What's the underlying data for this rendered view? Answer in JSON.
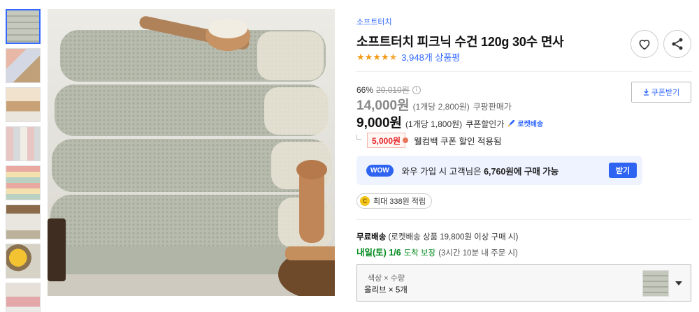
{
  "thumbnails": [
    {
      "name": "thumb-1",
      "active": true
    },
    {
      "name": "thumb-2",
      "active": false
    },
    {
      "name": "thumb-3",
      "active": false
    },
    {
      "name": "thumb-4",
      "active": false
    },
    {
      "name": "thumb-5",
      "active": false
    },
    {
      "name": "thumb-6",
      "active": false
    },
    {
      "name": "thumb-7",
      "active": false
    },
    {
      "name": "thumb-8",
      "active": false
    }
  ],
  "product": {
    "brand": "소프트터치",
    "title": "소프트터치 피크닉 수건 120g 30수 면사",
    "rating": 4.5,
    "review_count": "3,948개 상품평"
  },
  "pricing": {
    "discount_rate": "66%",
    "original_price": "20,010원",
    "info_icon": "i",
    "coupon_button": "쿠폰받기",
    "price": "14,000원",
    "price_unit": "(1개당 2,800원)",
    "price_label": "쿠팡판매가",
    "coupon_price": "9,000원",
    "coupon_price_unit": "(1개당 1,800원)",
    "coupon_price_label": "쿠폰할인가",
    "rocket_label": "로켓배송",
    "welcome_amount": "5,000원",
    "welcome_text": "웰컴백 쿠폰 할인 적용됨"
  },
  "wow": {
    "badge": "WOW",
    "text_prefix": "와우 가입 시 고객님은",
    "amount": "6,760원에 구매 가능",
    "button": "받기"
  },
  "points": {
    "coin": "C",
    "text": "최대 338원 적립"
  },
  "shipping": {
    "free_label": "무료배송",
    "free_detail": "(로켓배송 상품 19,800원 이상 구매 시)",
    "arrive_date": "내일(토) 1/6",
    "arrive_guarantee": "도착 보장",
    "arrive_condition": "(3시간 10분 내 주문 시)"
  },
  "option": {
    "header": "색상 × 수량",
    "value": "올리브 × 5개"
  },
  "colors": {
    "accent": "#346aff",
    "rating_star": "#f49a15",
    "sale_red": "#e52528",
    "delivery_green": "#00891a"
  }
}
